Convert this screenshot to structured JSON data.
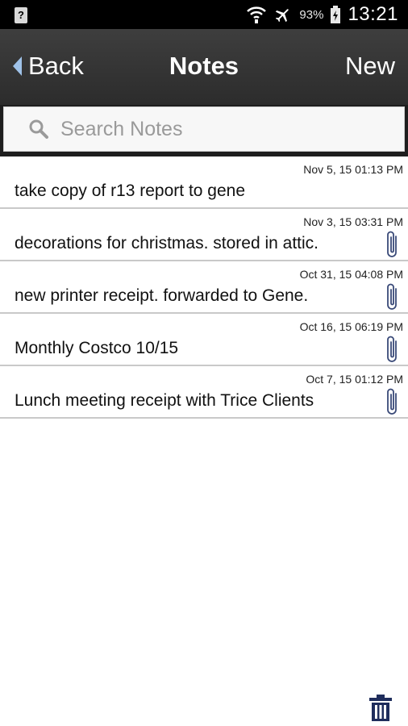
{
  "status_bar": {
    "battery_percent": "93%",
    "time": "13:21",
    "icons": [
      "unknown-notification-icon",
      "wifi-icon",
      "airplane-mode-icon",
      "battery-icon"
    ]
  },
  "header": {
    "back_label": "Back",
    "title": "Notes",
    "new_label": "New"
  },
  "search": {
    "placeholder": "Search Notes",
    "value": ""
  },
  "notes": [
    {
      "date": "Nov 5, 15 01:13 PM",
      "text": "take copy of r13 report to gene",
      "has_attachment": false
    },
    {
      "date": "Nov 3, 15 03:31 PM",
      "text": "decorations for christmas. stored in attic.",
      "has_attachment": true
    },
    {
      "date": "Oct 31, 15 04:08 PM",
      "text": "new printer receipt. forwarded to Gene.",
      "has_attachment": true
    },
    {
      "date": "Oct 16, 15 06:19 PM",
      "text": "Monthly Costco 10/15",
      "has_attachment": true
    },
    {
      "date": "Oct 7, 15 01:12 PM",
      "text": "Lunch meeting receipt with Trice Clients",
      "has_attachment": true
    }
  ],
  "colors": {
    "header_bg": "#333333",
    "accent_chevron": "#9fc2e8",
    "paperclip": "#3a4a78",
    "trash": "#1f2d5c"
  }
}
